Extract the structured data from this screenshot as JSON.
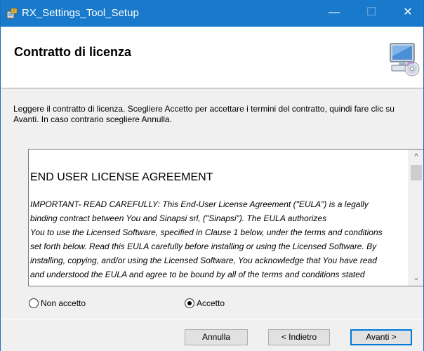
{
  "window": {
    "title": "RX_Settings_Tool_Setup",
    "controls": {
      "minimize": "—",
      "maximize": "☐",
      "close": "✕"
    }
  },
  "header": {
    "title": "Contratto di licenza",
    "icon": "computer-cd-icon"
  },
  "instructions": {
    "line1": "Leggere il contratto di licenza. Scegliere Accetto per accettare i termini del contratto, quindi fare clic su",
    "line2": "Avanti. In caso contrario scegliere Annulla."
  },
  "license": {
    "heading": "END USER LICENSE AGREEMENT",
    "lines": [
      "IMPORTANT- READ CAREFULLY: This End-User License Agreement (\"EULA\") is a legally",
      "binding contract between You and Sinapsi srl, (\"Sinapsi\"). The EULA authorizes",
      "You to use the Licensed Software, specified in Clause 1 below, under the terms and conditions",
      "set forth below. Read this EULA carefully before installing or using the Licensed Software. By",
      "installing, copying, and/or using the Licensed Software, You acknowledge that You have read",
      "and understood the EULA and agree to be bound by all of the terms and conditions stated"
    ],
    "scroll": {
      "up": "^",
      "down": "⌄"
    }
  },
  "options": {
    "reject": {
      "label": "Non accetto",
      "selected": false
    },
    "accept": {
      "label": "Accetto",
      "selected": true
    }
  },
  "buttons": {
    "cancel": "Annulla",
    "back": "< Indietro",
    "next": "Avanti >"
  },
  "colors": {
    "titlebar": "#1979ca",
    "focus_border": "#0078d7"
  }
}
